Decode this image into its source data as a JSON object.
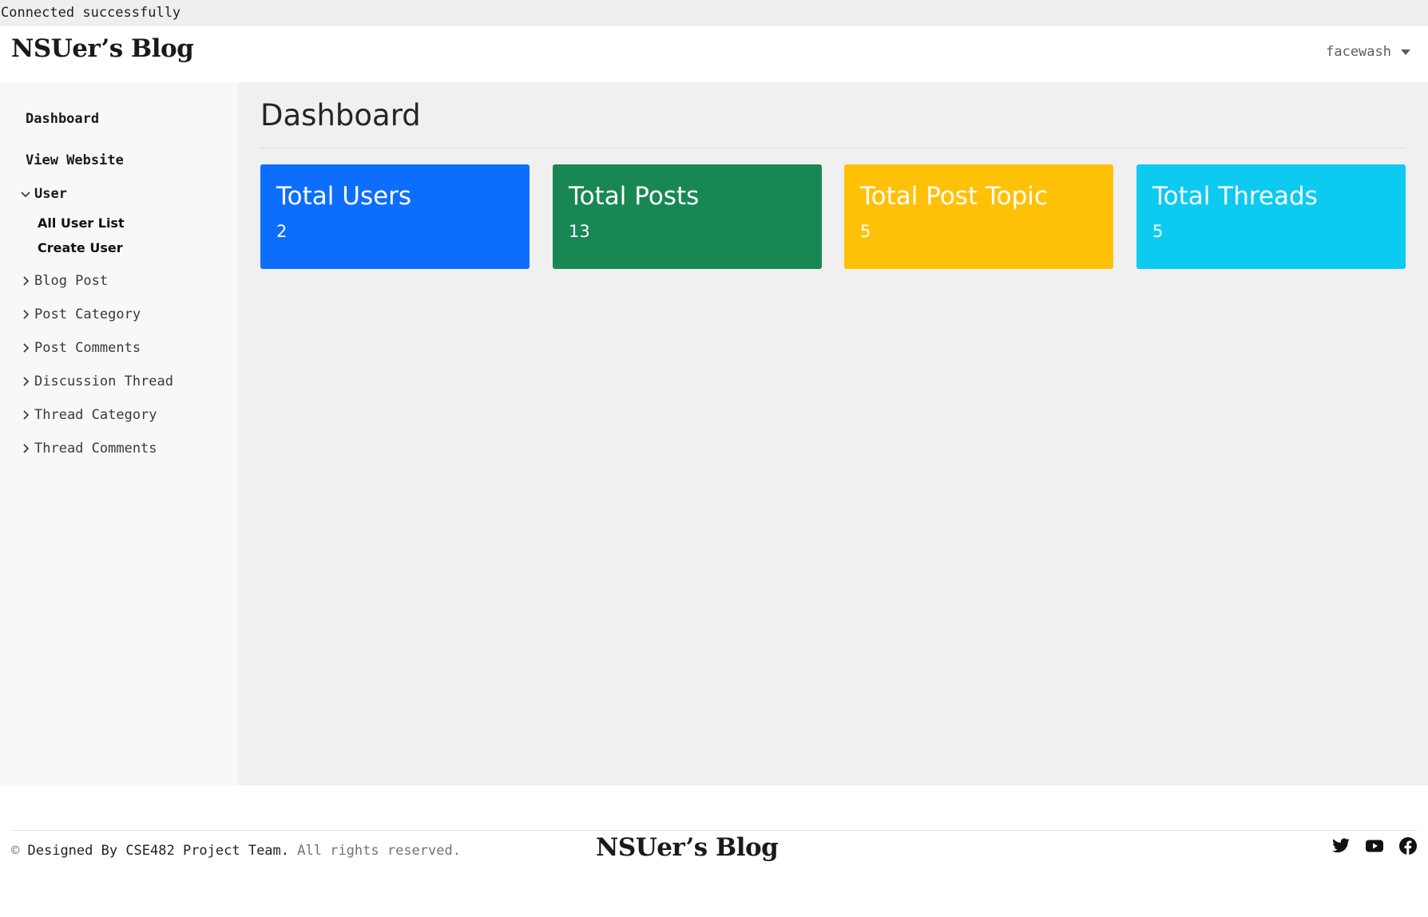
{
  "status_message": "Connected successfully",
  "header": {
    "brand": "NSUer’s Blog",
    "username": "facewash"
  },
  "sidebar": {
    "dashboard": "Dashboard",
    "view_website": "View Website",
    "user_group": {
      "label": "User",
      "expanded": true,
      "items": [
        "All User List",
        "Create User"
      ]
    },
    "groups": [
      "Blog Post",
      "Post Category",
      "Post Comments",
      "Discussion Thread",
      "Thread Category",
      "Thread Comments"
    ]
  },
  "main": {
    "title": "Dashboard",
    "cards": [
      {
        "title": "Total Users",
        "value": "2",
        "color": "#0d6efd"
      },
      {
        "title": "Total Posts",
        "value": "13",
        "color": "#198754"
      },
      {
        "title": "Total Post Topic",
        "value": "5",
        "color": "#ffc107"
      },
      {
        "title": "Total Threads",
        "value": "5",
        "color": "#0dcaf0"
      }
    ]
  },
  "footer": {
    "copyright_symbol": "©",
    "designed_by": "Designed By CSE482 Project Team.",
    "rights": "All rights reserved.",
    "brand": "NSUer’s Blog",
    "social_icons": [
      "twitter-icon",
      "youtube-icon",
      "facebook-icon"
    ]
  }
}
